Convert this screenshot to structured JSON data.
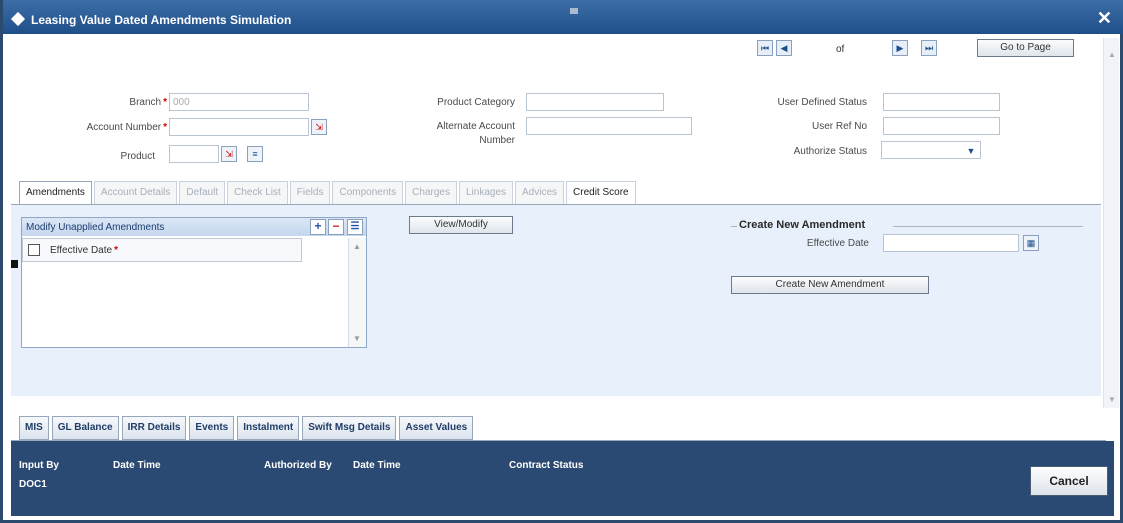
{
  "window": {
    "title": "Leasing Value Dated Amendments Simulation",
    "close": "✕"
  },
  "pager": {
    "first": "⏮",
    "prev": "◀",
    "of_label": "of",
    "next": "▶",
    "last": "⏭",
    "goto_label": "Go to Page"
  },
  "form": {
    "branch_label": "Branch",
    "branch_value": "000",
    "account_number_label": "Account Number",
    "product_label": "Product",
    "product_category_label": "Product Category",
    "alternate_account_label_1": "Alternate Account",
    "alternate_account_label_2": "Number",
    "user_defined_status_label": "User Defined Status",
    "user_ref_no_label": "User Ref No",
    "authorize_status_label": "Authorize Status",
    "required_mark": "*"
  },
  "tabs": [
    {
      "label": "Amendments"
    },
    {
      "label": "Account Details"
    },
    {
      "label": "Default"
    },
    {
      "label": "Check List"
    },
    {
      "label": "Fields"
    },
    {
      "label": "Components"
    },
    {
      "label": "Charges"
    },
    {
      "label": "Linkages"
    },
    {
      "label": "Advices"
    },
    {
      "label": "Credit Score"
    }
  ],
  "grid": {
    "title": "Modify Unapplied Amendments",
    "add": "+",
    "remove": "−",
    "view": "☰",
    "column_effective_date": "Effective Date"
  },
  "view_modify_label": "View/Modify",
  "create": {
    "section_title": "Create New Amendment",
    "effective_date_label": "Effective Date",
    "button_label": "Create New Amendment"
  },
  "bottom_tabs": [
    {
      "label": "MIS"
    },
    {
      "label": "GL Balance"
    },
    {
      "label": "IRR Details"
    },
    {
      "label": "Events"
    },
    {
      "label": "Instalment"
    },
    {
      "label": "Swift Msg Details"
    },
    {
      "label": "Asset Values"
    }
  ],
  "footer": {
    "input_by_label": "Input By",
    "input_by_value": "DOC1",
    "date_time_label_1": "Date Time",
    "authorized_by_label": "Authorized By",
    "date_time_label_2": "Date Time",
    "contract_status_label": "Contract Status",
    "cancel_label": "Cancel"
  },
  "colors": {
    "titlebar": "#1f4f8a",
    "footer": "#2a4a73",
    "panel": "#e7f0fb",
    "required": "#d40000"
  }
}
